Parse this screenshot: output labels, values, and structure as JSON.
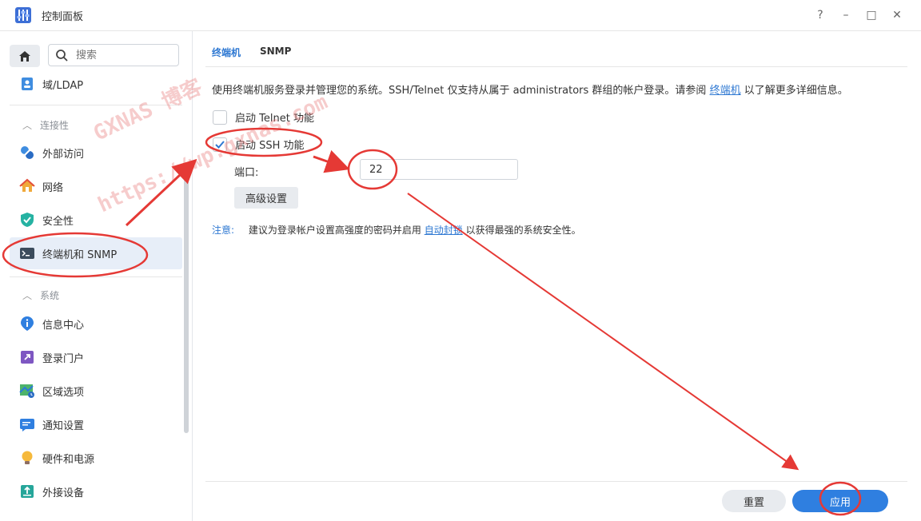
{
  "window": {
    "title": "控制面板",
    "help": "?",
    "minimize": "–",
    "maximize": "□",
    "close": "✕"
  },
  "sidebar": {
    "search_placeholder": "搜索",
    "items_top": [
      {
        "label": "域/LDAP",
        "icon": "directory-icon"
      }
    ],
    "sections": [
      {
        "title": "连接性",
        "items": [
          {
            "label": "外部访问",
            "icon": "external-access-icon"
          },
          {
            "label": "网络",
            "icon": "network-home-icon"
          },
          {
            "label": "安全性",
            "icon": "shield-check-icon"
          },
          {
            "label": "终端机和 SNMP",
            "icon": "terminal-icon",
            "active": true
          }
        ]
      },
      {
        "title": "系统",
        "items": [
          {
            "label": "信息中心",
            "icon": "info-pin-icon"
          },
          {
            "label": "登录门户",
            "icon": "login-portal-icon"
          },
          {
            "label": "区域选项",
            "icon": "regional-map-icon"
          },
          {
            "label": "通知设置",
            "icon": "notification-icon"
          },
          {
            "label": "硬件和电源",
            "icon": "lightbulb-icon"
          },
          {
            "label": "外接设备",
            "icon": "external-device-icon"
          }
        ]
      }
    ]
  },
  "main": {
    "tabs": [
      {
        "label": "终端机",
        "active": true
      },
      {
        "label": "SNMP",
        "active": false
      }
    ],
    "description": {
      "prefix": "使用终端机服务登录并管理您的系统。SSH/Telnet 仅支持从属于 administrators 群组的帐户登录。请参阅",
      "link": "终端机",
      "suffix": "以了解更多详细信息。"
    },
    "telnet": {
      "label": "启动 Telnet 功能",
      "checked": false
    },
    "ssh": {
      "label": "启动 SSH 功能",
      "checked": true
    },
    "port": {
      "label": "端口:",
      "value": "22"
    },
    "advanced_button": "高级设置",
    "note": {
      "label": "注意:",
      "prefix": "建议为登录帐户设置高强度的密码并启用",
      "link": "自动封锁",
      "suffix": "以获得最强的系统安全性。"
    },
    "reset_button": "重置",
    "apply_button": "应用"
  },
  "watermark": {
    "line1": "GXNAS 博客",
    "line2": "https://wp.gxnas.com"
  },
  "colors": {
    "accent": "#2e78d2",
    "apply": "#2f7fe0",
    "annotation": "#e53935"
  }
}
